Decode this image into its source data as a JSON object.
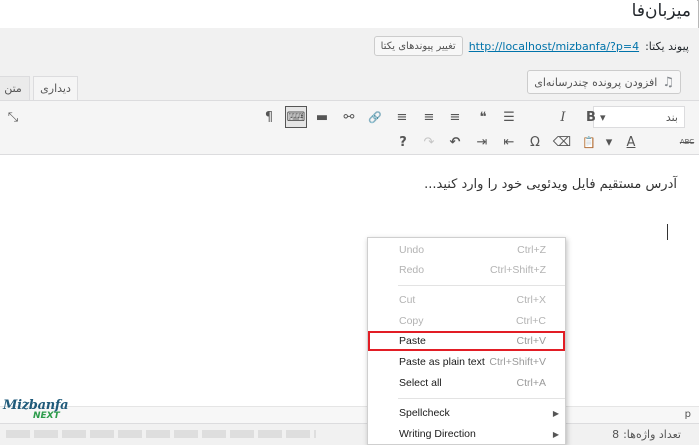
{
  "post_title": "میزبان‌فا",
  "permalink": {
    "label": "پیوند یکتا:",
    "url": "http://localhost/mizbanfa/?p=4",
    "change_button": "تغییر پیوندهای یکتا"
  },
  "media_button": {
    "label": "افزودن پرونده چندرسانه‌ای",
    "icon": "media-icon"
  },
  "tabs": {
    "visual": "دیداری",
    "text": "متن"
  },
  "toolbar": {
    "format_select": "بند",
    "row1_icons": [
      "bold-icon",
      "italic-icon",
      "unordered-list-icon",
      "blockquote-icon",
      "align-left-icon",
      "align-center-icon",
      "align-right-icon",
      "link-icon",
      "unlink-icon",
      "read-more-icon",
      "toolbar-toggle-icon",
      "paragraph-icon",
      "fullscreen-icon"
    ],
    "row2_icons": [
      "strikethrough-icon",
      "text-color-icon",
      "dropdown-icon",
      "paste-as-text-icon",
      "clear-formatting-icon",
      "special-character-icon",
      "outdent-icon",
      "indent-icon",
      "undo-icon",
      "redo-icon",
      "help-icon"
    ],
    "glyphs": {
      "bold": "B",
      "italic": "I",
      "ul": "☰",
      "quote": "❝",
      "al": "≡",
      "ac": "≡",
      "ar": "≡",
      "link": "🔗",
      "unlink": "⚯",
      "more": "▬",
      "kitchen": "⌨",
      "para": "¶",
      "full": "⤡",
      "strike": "ABC",
      "color": "A",
      "dd": "▾",
      "paste": "📋",
      "clear": "⌫",
      "omega": "Ω",
      "outdent": "⇤",
      "indent": "⇥",
      "undo": "↶",
      "redo": "↷",
      "help": "?"
    }
  },
  "editor": {
    "placeholder_text": "آدرس مستقیم فایل ویدئویی خود را وارد کنید..."
  },
  "statusbar": {
    "path": "p"
  },
  "footer": {
    "word_count_label": "تعداد واژه‌ها:",
    "word_count": "8"
  },
  "logo": {
    "line1": "Mizbanfa",
    "line2": "NEXT"
  },
  "context_menu": {
    "items": [
      {
        "label": "Undo",
        "shortcut": "Ctrl+Z",
        "state": "disabled"
      },
      {
        "label": "Redo",
        "shortcut": "Ctrl+Shift+Z",
        "state": "disabled"
      },
      {
        "label": "Cut",
        "shortcut": "Ctrl+X",
        "state": "disabled"
      },
      {
        "label": "Copy",
        "shortcut": "Ctrl+C",
        "state": "disabled"
      },
      {
        "label": "Paste",
        "shortcut": "Ctrl+V",
        "state": "enabled",
        "highlighted": true
      },
      {
        "label": "Paste as plain text",
        "shortcut": "Ctrl+Shift+V",
        "state": "enabled"
      },
      {
        "label": "Select all",
        "shortcut": "Ctrl+A",
        "state": "enabled"
      },
      {
        "label": "Spellcheck",
        "shortcut": "",
        "state": "enabled",
        "submenu": true
      },
      {
        "label": "Writing Direction",
        "shortcut": "",
        "state": "enabled",
        "submenu": true
      }
    ],
    "submenu_arrow": "▶"
  },
  "colors": {
    "link": "#0073aa",
    "highlight_border": "#e21d25",
    "toolbar_bg": "#f5f5f5",
    "workarea_bg": "#f1f1f1"
  }
}
